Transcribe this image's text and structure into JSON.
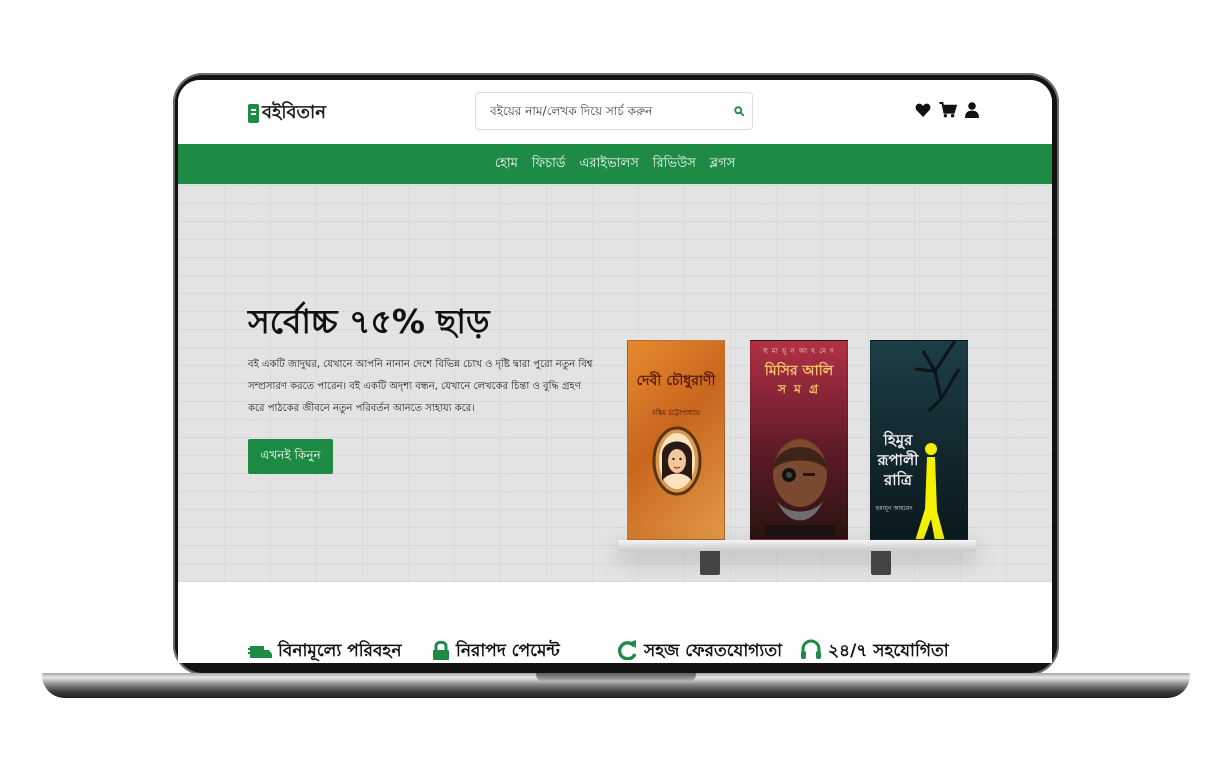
{
  "brand": {
    "name": "বইবিতান"
  },
  "search": {
    "placeholder": "বইয়ের নাম/লেখক দিয়ে সার্চ করুন"
  },
  "header": {
    "icons": [
      "heart-icon",
      "cart-icon",
      "user-icon"
    ]
  },
  "nav": {
    "items": [
      "হোম",
      "ফিচার্ড",
      "এরাইভালস",
      "রিভিউস",
      "ব্লগস"
    ]
  },
  "hero": {
    "title": "সর্বোচ্চ ৭৫% ছাড়",
    "description": "বই একটি জাদুঘর, যেখানে আপনি নানান দেশে বিভিন্ন চোখ ও দৃষ্টি দ্বারা পুরো নতুন বিশ্ব সম্প্রসারণ করতে পারেন। বই একটি অদৃশ্য বন্ধন, যেখানে লেখকের চিন্তা ও বুদ্ধি গ্রহণ করে পাঠকের জীবনে নতুন পরিবর্তন আনতে সাহায্য করে।",
    "cta": "এখনই কিনুন",
    "books": [
      {
        "title": "দেবী চৌধুরাণী",
        "author": "বঙ্কিম চট্টোপাধ্যায়"
      },
      {
        "title_line1": "মিসির আলি",
        "title_line2": "স ম গ্র",
        "author": "হু মা য়ূ ন  আ হ মে দ"
      },
      {
        "title_line1": "হিমুর",
        "title_line2": "রূপালী",
        "title_line3": "রাত্রি",
        "author": "হুমায়ূন আহমেদ"
      }
    ]
  },
  "features": [
    {
      "label": "বিনামূল্যে পরিবহন",
      "icon": "truck-icon"
    },
    {
      "label": "নিরাপদ পেমেন্ট",
      "icon": "lock-icon"
    },
    {
      "label": "সহজ ফেরতযোগ্যতা",
      "icon": "redo-icon"
    },
    {
      "label": "২৪/৭ সহযোগিতা",
      "icon": "headset-icon"
    }
  ],
  "colors": {
    "accent": "#1e8b45",
    "text": "#111111",
    "hero_bg": "#e3e3e3"
  }
}
